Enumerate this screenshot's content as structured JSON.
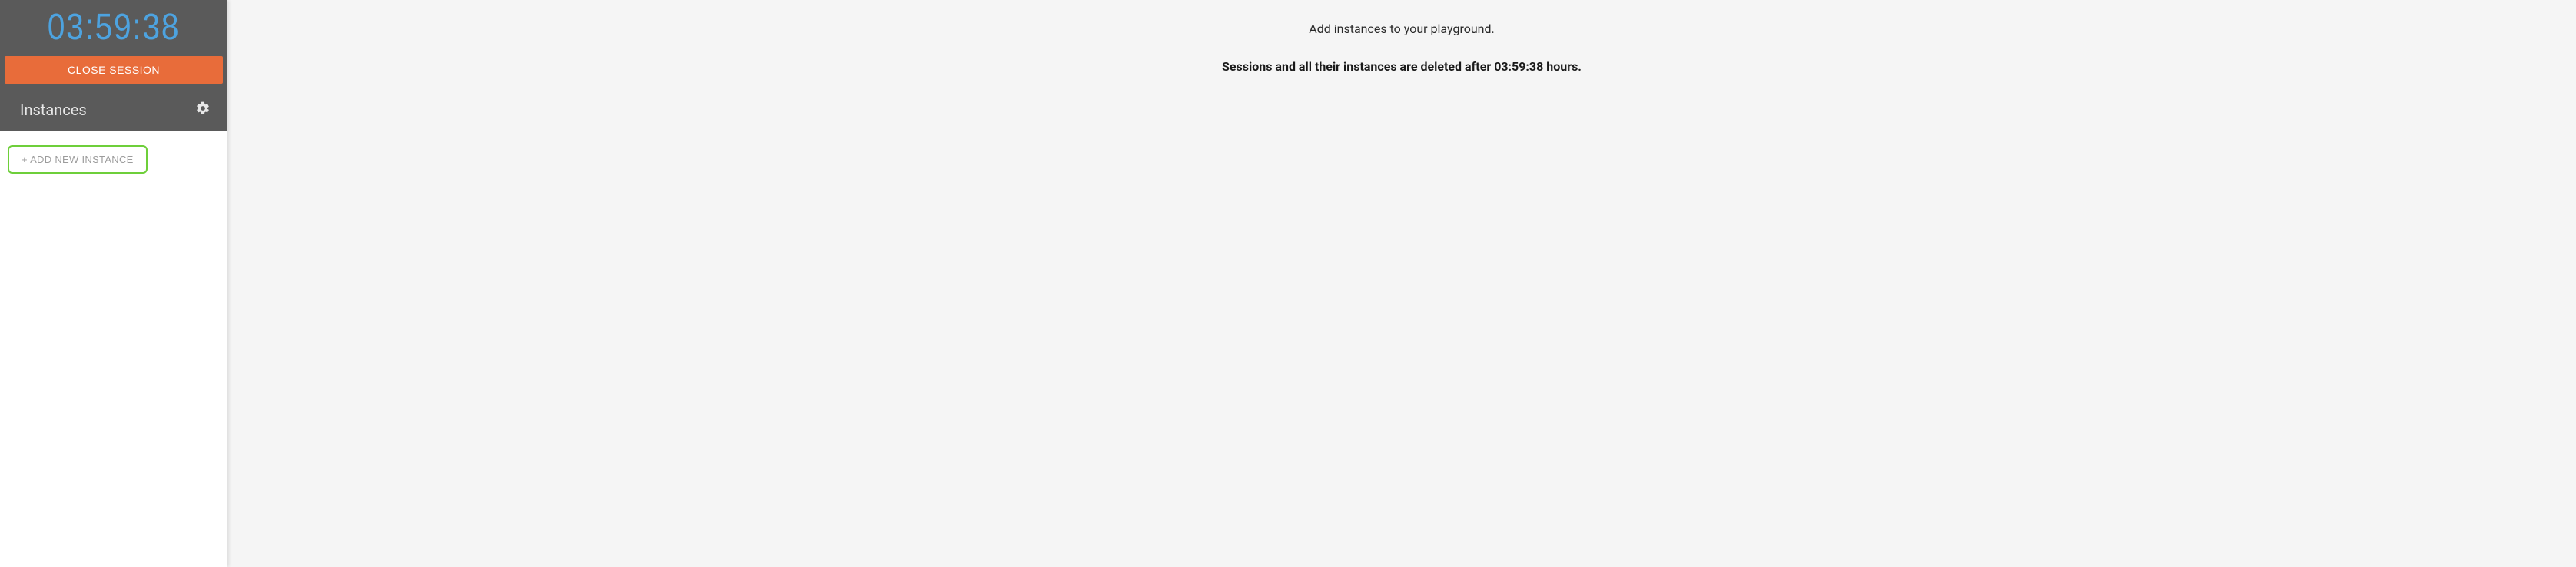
{
  "sidebar": {
    "timer": "03:59:38",
    "close_session_label": "CLOSE SESSION",
    "instances_header": "Instances",
    "add_instance_label": "+ ADD NEW INSTANCE"
  },
  "main": {
    "line1": "Add instances to your playground.",
    "line2": "Sessions and all their instances are deleted after 03:59:38 hours."
  },
  "colors": {
    "timer": "#4da3e0",
    "close_btn": "#e86c3a",
    "add_border": "#6ecf3a",
    "sidebar_dark": "#5a5a5a"
  }
}
